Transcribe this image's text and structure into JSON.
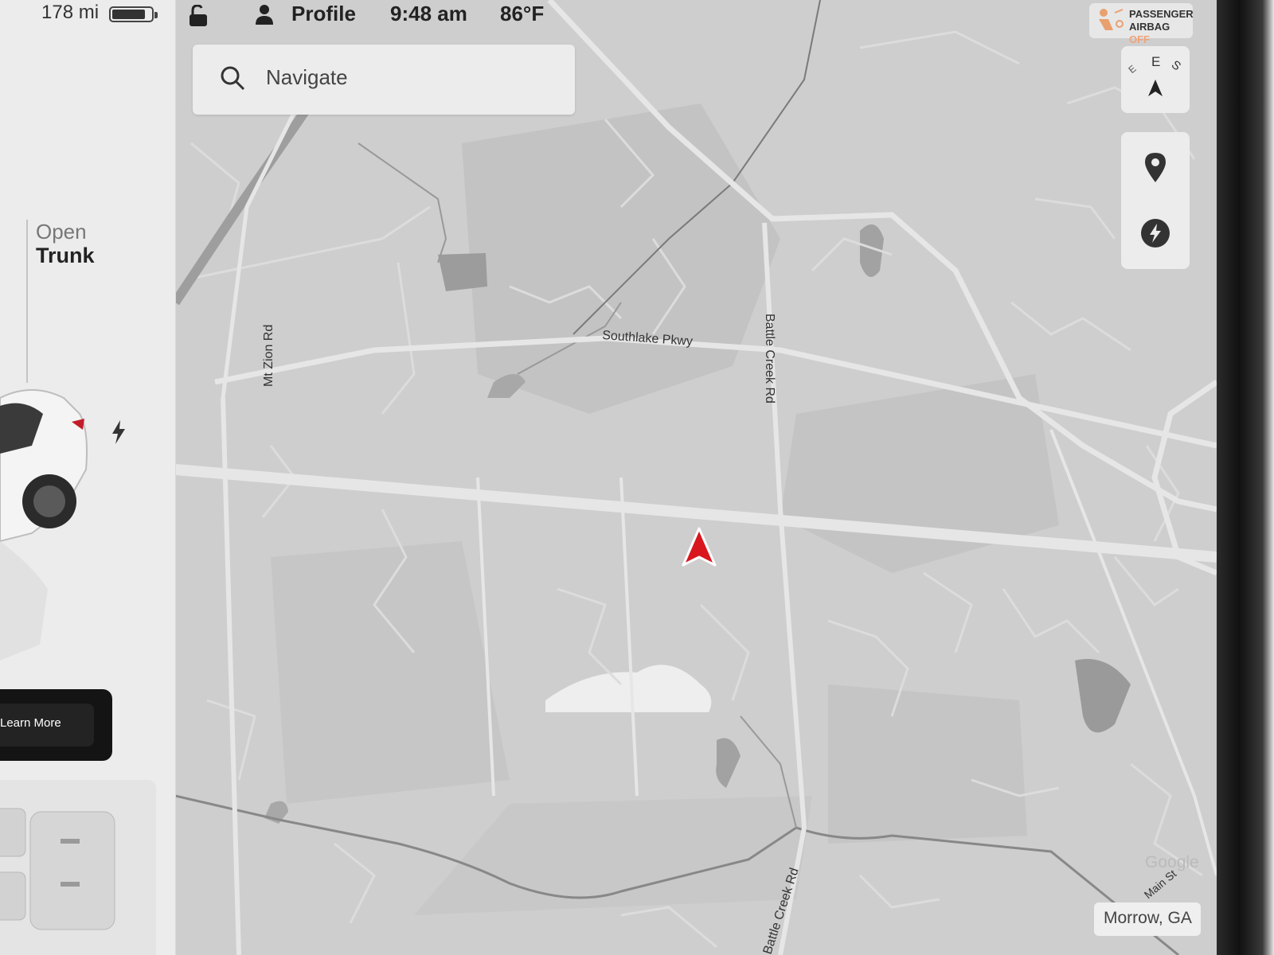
{
  "status_bar": {
    "range": "178 mi",
    "battery_level": 0.85,
    "profile_label": "Profile",
    "time": "9:48 am",
    "temperature": "86°F",
    "lock_icon": "unlocked-padlock-icon",
    "profile_icon": "person-icon"
  },
  "airbag": {
    "line1": "PASSENGER",
    "line2_prefix": "AIRBAG",
    "line2_state": "OFF",
    "icon": "passenger-airbag-icon",
    "state_color": "#f1a37a"
  },
  "left_panel": {
    "trunk_line1": "Open",
    "trunk_line2": "Trunk",
    "learn_more_label": "Learn More",
    "charge_icon": "lightning-bolt-icon"
  },
  "search": {
    "placeholder": "Navigate",
    "icon": "search-icon"
  },
  "compass": {
    "heading_letters": [
      "E",
      "S",
      "E"
    ],
    "icon": "heading-arrow-icon"
  },
  "map_tools": {
    "pin_icon": "map-pin-icon",
    "charger_icon": "supercharger-icon"
  },
  "map": {
    "roads": {
      "southlake": "Southlake Pkwy",
      "mt_zion": "Mt Zion Rd",
      "battle_creek_north": "Battle Creek Rd",
      "battle_creek_south": "Battle Creek Rd",
      "main_st": "Main St"
    },
    "attribution": "Google",
    "location": "Morrow, GA",
    "vehicle_marker_color": "#d9161d"
  }
}
